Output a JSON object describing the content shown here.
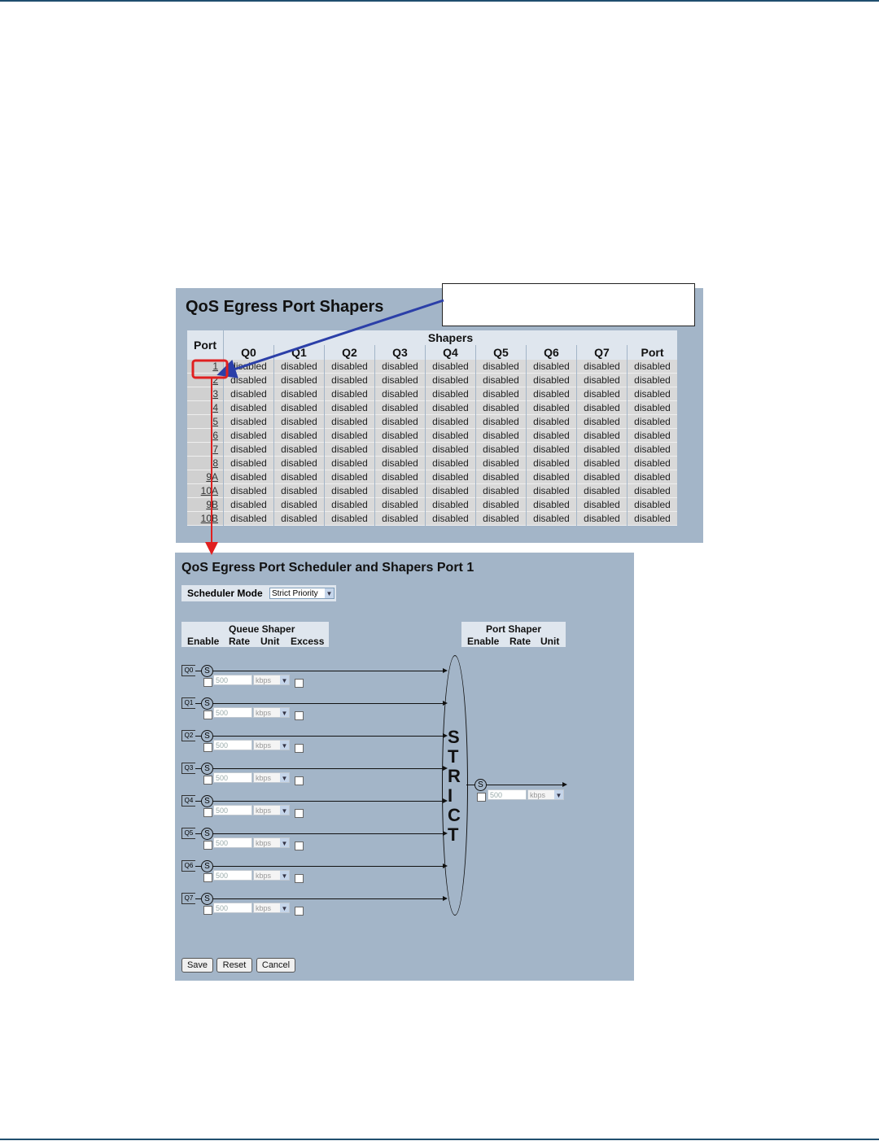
{
  "top": {
    "title": "QoS Egress Port Shapers",
    "table": {
      "port_header": "Port",
      "shapers_header": "Shapers",
      "columns": [
        "Q0",
        "Q1",
        "Q2",
        "Q3",
        "Q4",
        "Q5",
        "Q6",
        "Q7",
        "Port"
      ],
      "rows": [
        {
          "port": "1",
          "values": [
            "disabled",
            "disabled",
            "disabled",
            "disabled",
            "disabled",
            "disabled",
            "disabled",
            "disabled",
            "disabled"
          ]
        },
        {
          "port": "2",
          "values": [
            "disabled",
            "disabled",
            "disabled",
            "disabled",
            "disabled",
            "disabled",
            "disabled",
            "disabled",
            "disabled"
          ]
        },
        {
          "port": "3",
          "values": [
            "disabled",
            "disabled",
            "disabled",
            "disabled",
            "disabled",
            "disabled",
            "disabled",
            "disabled",
            "disabled"
          ]
        },
        {
          "port": "4",
          "values": [
            "disabled",
            "disabled",
            "disabled",
            "disabled",
            "disabled",
            "disabled",
            "disabled",
            "disabled",
            "disabled"
          ]
        },
        {
          "port": "5",
          "values": [
            "disabled",
            "disabled",
            "disabled",
            "disabled",
            "disabled",
            "disabled",
            "disabled",
            "disabled",
            "disabled"
          ]
        },
        {
          "port": "6",
          "values": [
            "disabled",
            "disabled",
            "disabled",
            "disabled",
            "disabled",
            "disabled",
            "disabled",
            "disabled",
            "disabled"
          ]
        },
        {
          "port": "7",
          "values": [
            "disabled",
            "disabled",
            "disabled",
            "disabled",
            "disabled",
            "disabled",
            "disabled",
            "disabled",
            "disabled"
          ]
        },
        {
          "port": "8",
          "values": [
            "disabled",
            "disabled",
            "disabled",
            "disabled",
            "disabled",
            "disabled",
            "disabled",
            "disabled",
            "disabled"
          ]
        },
        {
          "port": "9A",
          "values": [
            "disabled",
            "disabled",
            "disabled",
            "disabled",
            "disabled",
            "disabled",
            "disabled",
            "disabled",
            "disabled"
          ]
        },
        {
          "port": "10A",
          "values": [
            "disabled",
            "disabled",
            "disabled",
            "disabled",
            "disabled",
            "disabled",
            "disabled",
            "disabled",
            "disabled"
          ]
        },
        {
          "port": "9B",
          "values": [
            "disabled",
            "disabled",
            "disabled",
            "disabled",
            "disabled",
            "disabled",
            "disabled",
            "disabled",
            "disabled"
          ]
        },
        {
          "port": "10B",
          "values": [
            "disabled",
            "disabled",
            "disabled",
            "disabled",
            "disabled",
            "disabled",
            "disabled",
            "disabled",
            "disabled"
          ]
        }
      ]
    }
  },
  "bottom": {
    "title": "QoS Egress Port Scheduler and Shapers  Port 1",
    "scheduler_mode_label": "Scheduler Mode",
    "scheduler_mode_value": "Strict Priority",
    "queue_shaper": {
      "title": "Queue Shaper",
      "headers": [
        "Enable",
        "Rate",
        "Unit",
        "Excess"
      ]
    },
    "port_shaper": {
      "title": "Port Shaper",
      "headers": [
        "Enable",
        "Rate",
        "Unit"
      ],
      "rate": "500",
      "unit": "kbps"
    },
    "queues": [
      {
        "label": "Q0",
        "rate": "500",
        "unit": "kbps"
      },
      {
        "label": "Q1",
        "rate": "500",
        "unit": "kbps"
      },
      {
        "label": "Q2",
        "rate": "500",
        "unit": "kbps"
      },
      {
        "label": "Q3",
        "rate": "500",
        "unit": "kbps"
      },
      {
        "label": "Q4",
        "rate": "500",
        "unit": "kbps"
      },
      {
        "label": "Q5",
        "rate": "500",
        "unit": "kbps"
      },
      {
        "label": "Q6",
        "rate": "500",
        "unit": "kbps"
      },
      {
        "label": "Q7",
        "rate": "500",
        "unit": "kbps"
      }
    ],
    "shaper_symbol": "S",
    "strict_letters": [
      "S",
      "T",
      "R",
      "I",
      "C",
      "T"
    ],
    "buttons": {
      "save": "Save",
      "reset": "Reset",
      "cancel": "Cancel"
    }
  },
  "colors": {
    "panel": "#a3b5c8",
    "header": "#dfe6ee",
    "callout_arrow": "#2b3fa8",
    "link_arrow": "#e02020"
  }
}
